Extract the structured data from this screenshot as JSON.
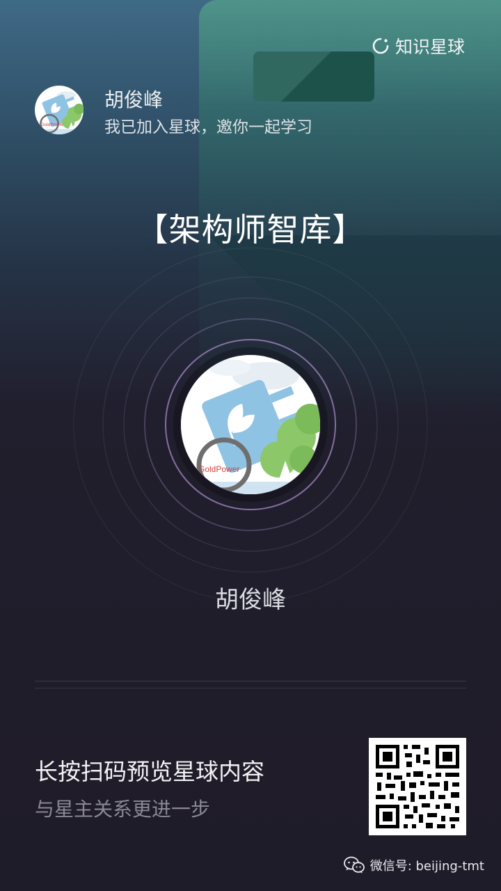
{
  "brand": {
    "name": "知识星球",
    "icon": "planet-ring-icon"
  },
  "owner": {
    "name": "胡俊峰",
    "invite_text": "我已加入星球，邀你一起学习",
    "avatar_label": "GoldPower"
  },
  "planet": {
    "title": "【架构师智库】",
    "owner_name": "胡俊峰",
    "avatar_label": "GoldPower"
  },
  "cta": {
    "main": "长按扫码预览星球内容",
    "sub": "与星主关系更进一步"
  },
  "footer": {
    "label": "微信号: beijing-tmt",
    "icon": "wechat-icon"
  },
  "colors": {
    "accent_ring": "#8a6fb0",
    "background": "#1f1c29"
  }
}
